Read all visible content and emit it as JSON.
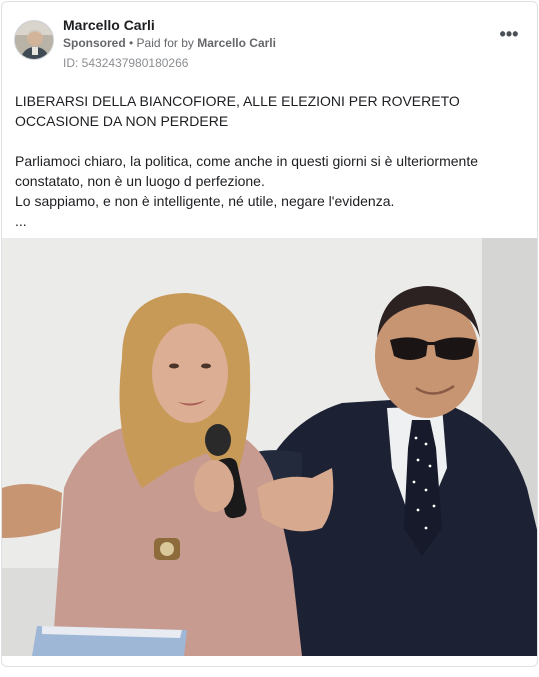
{
  "post": {
    "page_name": "Marcello Carli",
    "sponsored_label": "Sponsored",
    "paid_for_prefix": "• Paid for by",
    "paid_for_name": "Marcello Carli",
    "ad_id": "ID: 5432437980180266",
    "more_icon": "more-horizontal-icon",
    "more_glyph": "•••",
    "headline": "LIBERARSI DELLA BIANCOFIORE, ALLE ELEZIONI PER ROVERETO OCCASIONE DA NON PERDERE",
    "paragraph_1": "Parliamoci chiaro, la politica, come anche in questi giorni si è ulteriormente constatato, non è un luogo d perfezione.",
    "paragraph_2": "Lo sappiamo, e non è intelligente, né utile, negare l'evidenza.",
    "ellipsis": "..."
  },
  "colors": {
    "text_primary": "#1c1e21",
    "text_secondary": "#65676b",
    "border": "#dfe1e5"
  }
}
